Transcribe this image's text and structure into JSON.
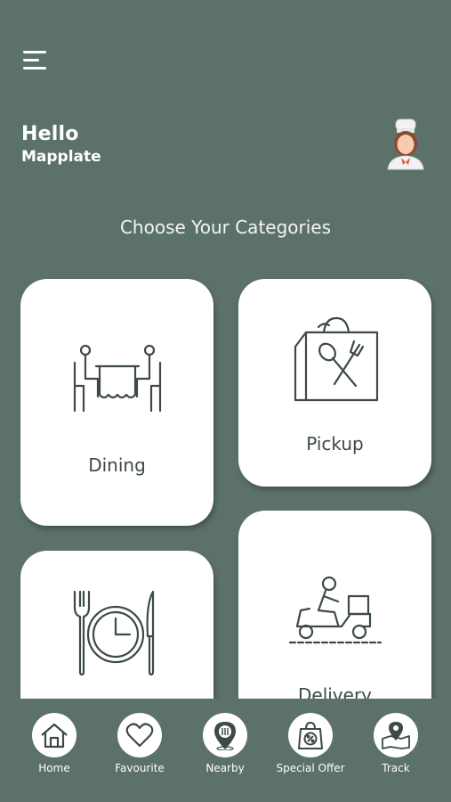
{
  "header": {
    "greeting": "Hello",
    "username": "Mapplate"
  },
  "section_title": "Choose Your Categories",
  "categories": [
    {
      "label": "Dining",
      "icon": "dining-table-icon"
    },
    {
      "label": "Pickup",
      "icon": "shopping-bag-cutlery-icon"
    },
    {
      "label": "",
      "icon": "plate-clock-cutlery-icon"
    },
    {
      "label": "Delivery",
      "icon": "scooter-delivery-icon"
    }
  ],
  "bottom_nav": [
    {
      "label": "Home",
      "icon": "home-icon"
    },
    {
      "label": "Favourite",
      "icon": "heart-icon"
    },
    {
      "label": "Nearby",
      "icon": "location-pin-icon"
    },
    {
      "label": "Special Offer",
      "icon": "offer-bag-icon"
    },
    {
      "label": "Track",
      "icon": "map-track-icon"
    }
  ],
  "colors": {
    "background": "#5b7169",
    "card": "#ffffff",
    "icon_stroke": "#3d4a45"
  }
}
